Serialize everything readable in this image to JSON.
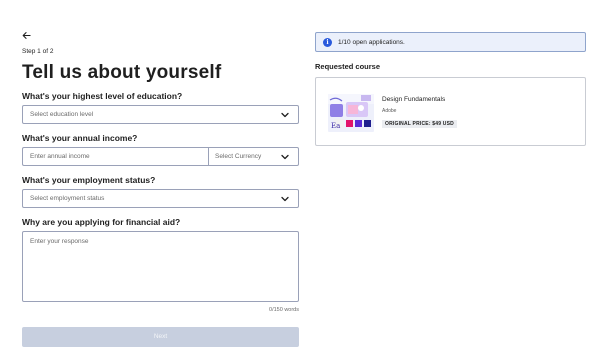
{
  "nav": {
    "back_icon": "arrow-left-icon"
  },
  "step": "Step 1 of 2",
  "title": "Tell us about yourself",
  "education": {
    "label": "What's your highest level of education?",
    "placeholder": "Select education level"
  },
  "income": {
    "label": "What's your annual income?",
    "placeholder": "Enter annual income",
    "currency_placeholder": "Select Currency"
  },
  "employment": {
    "label": "What's your employment status?",
    "placeholder": "Select employment status"
  },
  "reason": {
    "label": "Why are you applying for financial aid?",
    "placeholder": "Enter your response",
    "word_count": "0/150 words"
  },
  "next_label": "Next",
  "banner": {
    "icon": "info-icon",
    "text": "1/10 open applications."
  },
  "requested": {
    "heading": "Requested course",
    "course_name": "Design Fundamentals",
    "org": "Adobe",
    "price": "ORIGINAL PRICE: $49 USD"
  },
  "colors": {
    "accent": "#2a5adc",
    "disabled_button": "#c7cfdf",
    "field_border": "#9aa1b8",
    "banner_bg": "#ebf0fb"
  }
}
